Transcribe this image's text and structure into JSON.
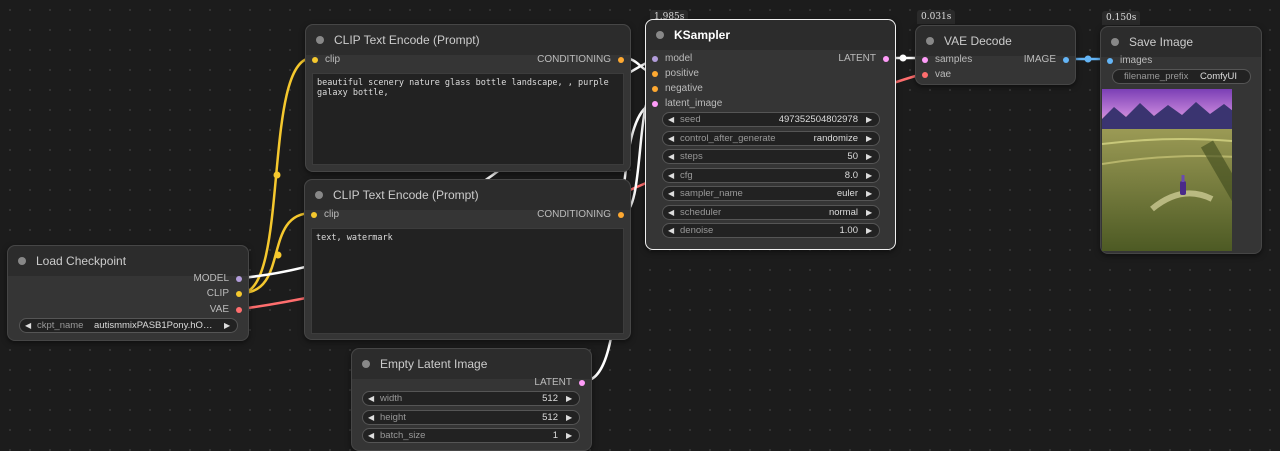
{
  "colors": {
    "clip": "#f5c82e",
    "model": "#b39ddb",
    "vae": "#ff6e6e",
    "conditioning": "#ffa931",
    "latent": "#ff9cf9",
    "image": "#64b5f6",
    "link_white": "#ffffff"
  },
  "nodes": {
    "clip_pos": {
      "title": "CLIP Text Encode (Prompt)",
      "in_clip": "clip",
      "out_conditioning": "CONDITIONING",
      "text": "beautiful scenery nature glass bottle landscape, , purple galaxy bottle,"
    },
    "clip_neg": {
      "title": "CLIP Text Encode (Prompt)",
      "in_clip": "clip",
      "out_conditioning": "CONDITIONING",
      "text": "text, watermark"
    },
    "load_ckpt": {
      "title": "Load Checkpoint",
      "out_model": "MODEL",
      "out_clip": "CLIP",
      "out_vae": "VAE",
      "w_ckpt_label": "ckpt_name",
      "w_ckpt_value": "autismmixPASB1Pony.hODI…"
    },
    "empty_latent": {
      "title": "Empty Latent Image",
      "out_latent": "LATENT",
      "w_width_label": "width",
      "w_width_value": "512",
      "w_height_label": "height",
      "w_height_value": "512",
      "w_batch_label": "batch_size",
      "w_batch_value": "1"
    },
    "ksampler": {
      "timing": "1.985s",
      "title": "KSampler",
      "in_model": "model",
      "in_positive": "positive",
      "in_negative": "negative",
      "in_latent": "latent_image",
      "out_latent": "LATENT",
      "widgets": [
        {
          "label": "seed",
          "value": "497352504802978"
        },
        {
          "label": "control_after_generate",
          "value": "randomize"
        },
        {
          "label": "steps",
          "value": "50"
        },
        {
          "label": "cfg",
          "value": "8.0"
        },
        {
          "label": "sampler_name",
          "value": "euler"
        },
        {
          "label": "scheduler",
          "value": "normal"
        },
        {
          "label": "denoise",
          "value": "1.00"
        }
      ]
    },
    "vae_decode": {
      "timing": "0.031s",
      "title": "VAE Decode",
      "in_samples": "samples",
      "in_vae": "vae",
      "out_image": "IMAGE"
    },
    "save_image": {
      "timing": "0.150s",
      "title": "Save Image",
      "in_images": "images",
      "w_prefix_label": "filename_prefix",
      "w_prefix_value": "ComfyUI"
    }
  }
}
